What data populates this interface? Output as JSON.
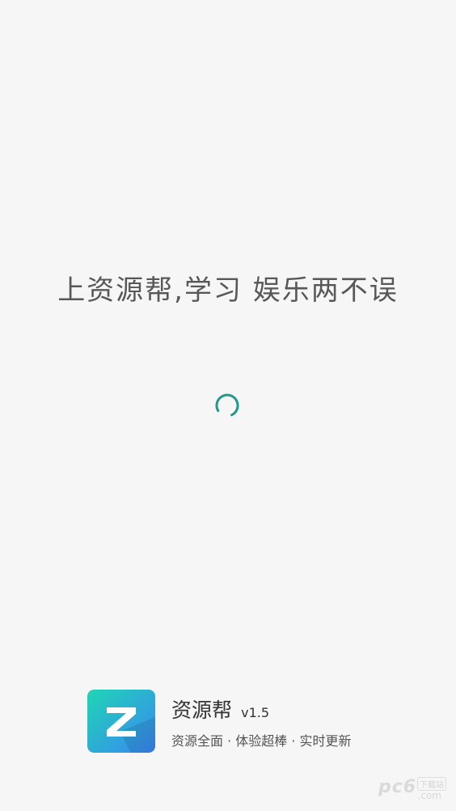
{
  "splash": {
    "slogan": "上资源帮,学习 娱乐两不误",
    "accent_color": "#1f9a8a",
    "spinner_icon": "loading-spinner-icon"
  },
  "app": {
    "name": "资源帮",
    "version": "v1.5",
    "tagline": "资源全面 · 体验超棒 · 实时更新",
    "logo_letter": "Z",
    "logo_colors": [
      "#22d3b6",
      "#3a8ef2"
    ]
  },
  "watermark": {
    "brand": "pc6",
    "cn": "下载站",
    "domain": ".com"
  }
}
